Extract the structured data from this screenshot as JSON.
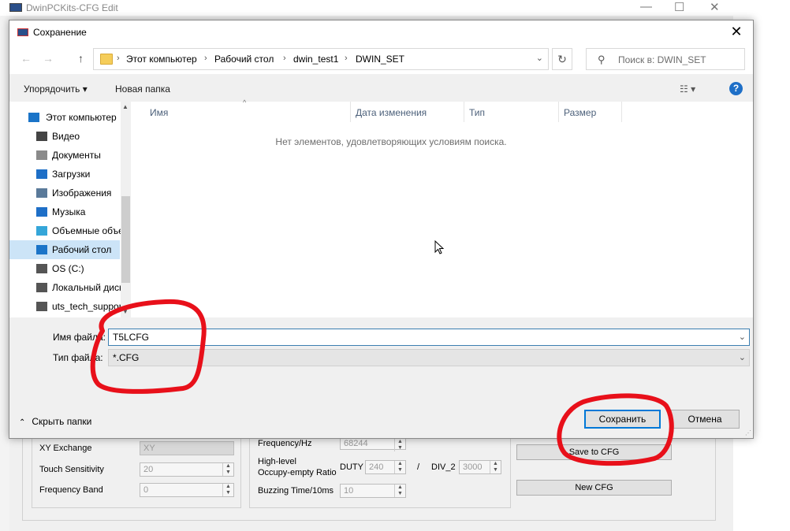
{
  "background_app": {
    "title": "DwinPCKits-CFG Edit",
    "controls": [
      "—",
      "☐",
      "✕"
    ],
    "labels": {
      "xy_exchange": "XY Exchange",
      "touch_sensitivity": "Touch Sensitivity",
      "frequency_band": "Frequency Band",
      "frequency_hz": "Frequency/Hz",
      "high_level_line1": "High-level",
      "high_level_line2": "Occupy-empty Ratio",
      "duty": "DUTY",
      "slash": "/",
      "div2": "DIV_2",
      "buzzing_time": "Buzzing Time/10ms"
    },
    "values": {
      "xy_exchange": "XY",
      "touch_sensitivity": "20",
      "frequency_band": "0",
      "frequency_hz": "68244",
      "duty": "240",
      "div2": "3000",
      "buzzing_time": "10"
    },
    "buttons": {
      "save_to_cfg": "Save to CFG",
      "new_cfg": "New CFG"
    }
  },
  "dialog": {
    "title": "Сохранение",
    "close_glyph": "✕",
    "nav": {
      "back": "←",
      "forward": "→",
      "up": "↑",
      "refresh": "↻"
    },
    "breadcrumbs": [
      "Этот компьютер",
      "Рабочий стол",
      "dwin_test1",
      "DWIN_SET"
    ],
    "crumb_separator": "›",
    "search_placeholder": "Поиск в: DWIN_SET",
    "toolbar": {
      "organize": "Упорядочить ▾",
      "new_folder": "Новая папка",
      "view": "☷ ▾",
      "help": "?"
    },
    "tree": [
      {
        "label": "Этот компьютер",
        "icon": "computer-icon",
        "color": "#1b74c8"
      },
      {
        "label": "Видео",
        "icon": "video-icon",
        "color": "#444444"
      },
      {
        "label": "Документы",
        "icon": "documents-icon",
        "color": "#8a8a8a"
      },
      {
        "label": "Загрузки",
        "icon": "downloads-icon",
        "color": "#1e6fc7"
      },
      {
        "label": "Изображения",
        "icon": "pictures-icon",
        "color": "#5a7a9a"
      },
      {
        "label": "Музыка",
        "icon": "music-icon",
        "color": "#1e6fc7"
      },
      {
        "label": "Объемные объекты",
        "icon": "3d-objects-icon",
        "color": "#35a6d9"
      },
      {
        "label": "Рабочий стол",
        "icon": "desktop-icon",
        "color": "#1b74c8"
      },
      {
        "label": "OS (C:)",
        "icon": "drive-icon",
        "color": "#555555"
      },
      {
        "label": "Локальный диск",
        "icon": "drive-icon",
        "color": "#555555"
      },
      {
        "label": "uts_tech_support",
        "icon": "network-drive-icon",
        "color": "#555555"
      }
    ],
    "selected_tree_index": 7,
    "columns": [
      "Имя",
      "Дата изменения",
      "Тип",
      "Размер"
    ],
    "empty_message": "Нет элементов, удовлетворяющих условиям поиска.",
    "filename_label": "Имя файла:",
    "filename_value": "T5LCFG",
    "filetype_label": "Тип файла:",
    "filetype_value": "*.CFG",
    "hide_folders": "Скрыть папки",
    "save_button": "Сохранить",
    "cancel_button": "Отмена"
  },
  "annotation_color": "#e8101a"
}
